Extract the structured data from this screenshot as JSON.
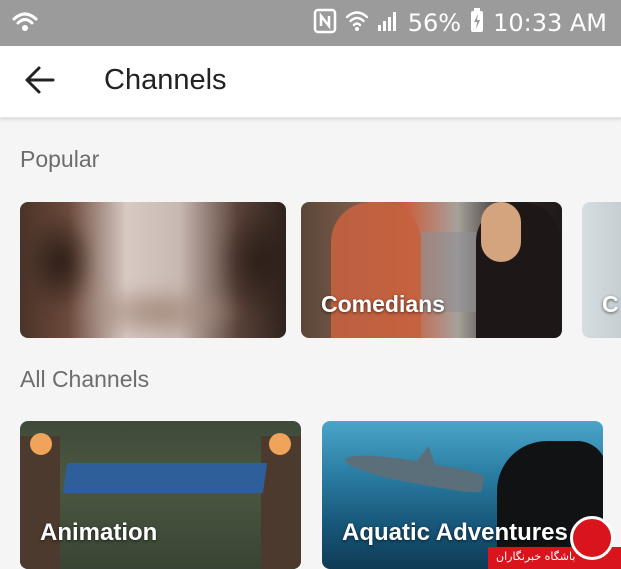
{
  "status_bar": {
    "battery": "56%",
    "time": "10:33 AM",
    "icons": [
      "wifi-calling-icon",
      "nfc-icon",
      "wifi-icon",
      "signal-icon",
      "battery-charging-icon"
    ]
  },
  "app_bar": {
    "title": "Channels",
    "back_icon": "arrow-left-icon"
  },
  "sections": {
    "popular": {
      "title": "Popular",
      "cards": [
        {
          "label": ""
        },
        {
          "label": "Comedians"
        },
        {
          "label": "C"
        }
      ]
    },
    "all": {
      "title": "All Channels",
      "cards": [
        {
          "label": "Animation"
        },
        {
          "label": "Aquatic Adventures"
        }
      ]
    }
  },
  "watermark": {
    "text": "باشگاه خبرنگاران"
  },
  "colors": {
    "status_bar_bg": "#9b9b9b",
    "app_bar_bg": "#ffffff",
    "page_bg": "#f5f5f5",
    "section_title": "#6d6d6d"
  }
}
